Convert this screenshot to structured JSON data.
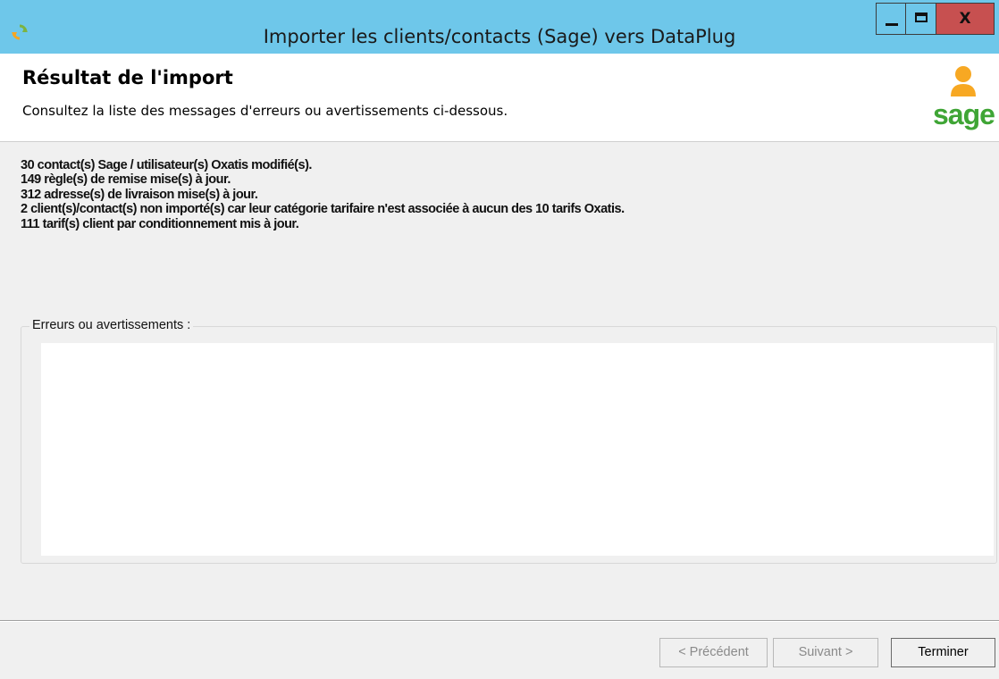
{
  "window": {
    "title": "Importer les clients/contacts (Sage) vers DataPlug",
    "close_label": "X"
  },
  "header": {
    "title": "Résultat de l'import",
    "subtitle": "Consultez la liste des messages d'erreurs ou avertissements ci-dessous.",
    "logo_text": "sage",
    "logo_color": "#3fa535",
    "logo_icon_color": "#f7a823"
  },
  "summary": {
    "lines": [
      "30 contact(s) Sage / utilisateur(s) Oxatis modifié(s).",
      "149 règle(s) de remise mise(s) à jour.",
      "312 adresse(s) de livraison mise(s) à jour.",
      "2 client(s)/contact(s) non importé(s) car leur catégorie tarifaire n'est associée à aucun des 10 tarifs Oxatis.",
      "111 tarif(s) client par conditionnement mis à jour."
    ]
  },
  "errors": {
    "label": "Erreurs ou avertissements :",
    "items": []
  },
  "footer": {
    "prev_label": "< Précédent",
    "next_label": "Suivant >",
    "finish_label": "Terminer"
  },
  "colors": {
    "titlebar": "#6ec7ea",
    "close_button": "#c75050"
  }
}
